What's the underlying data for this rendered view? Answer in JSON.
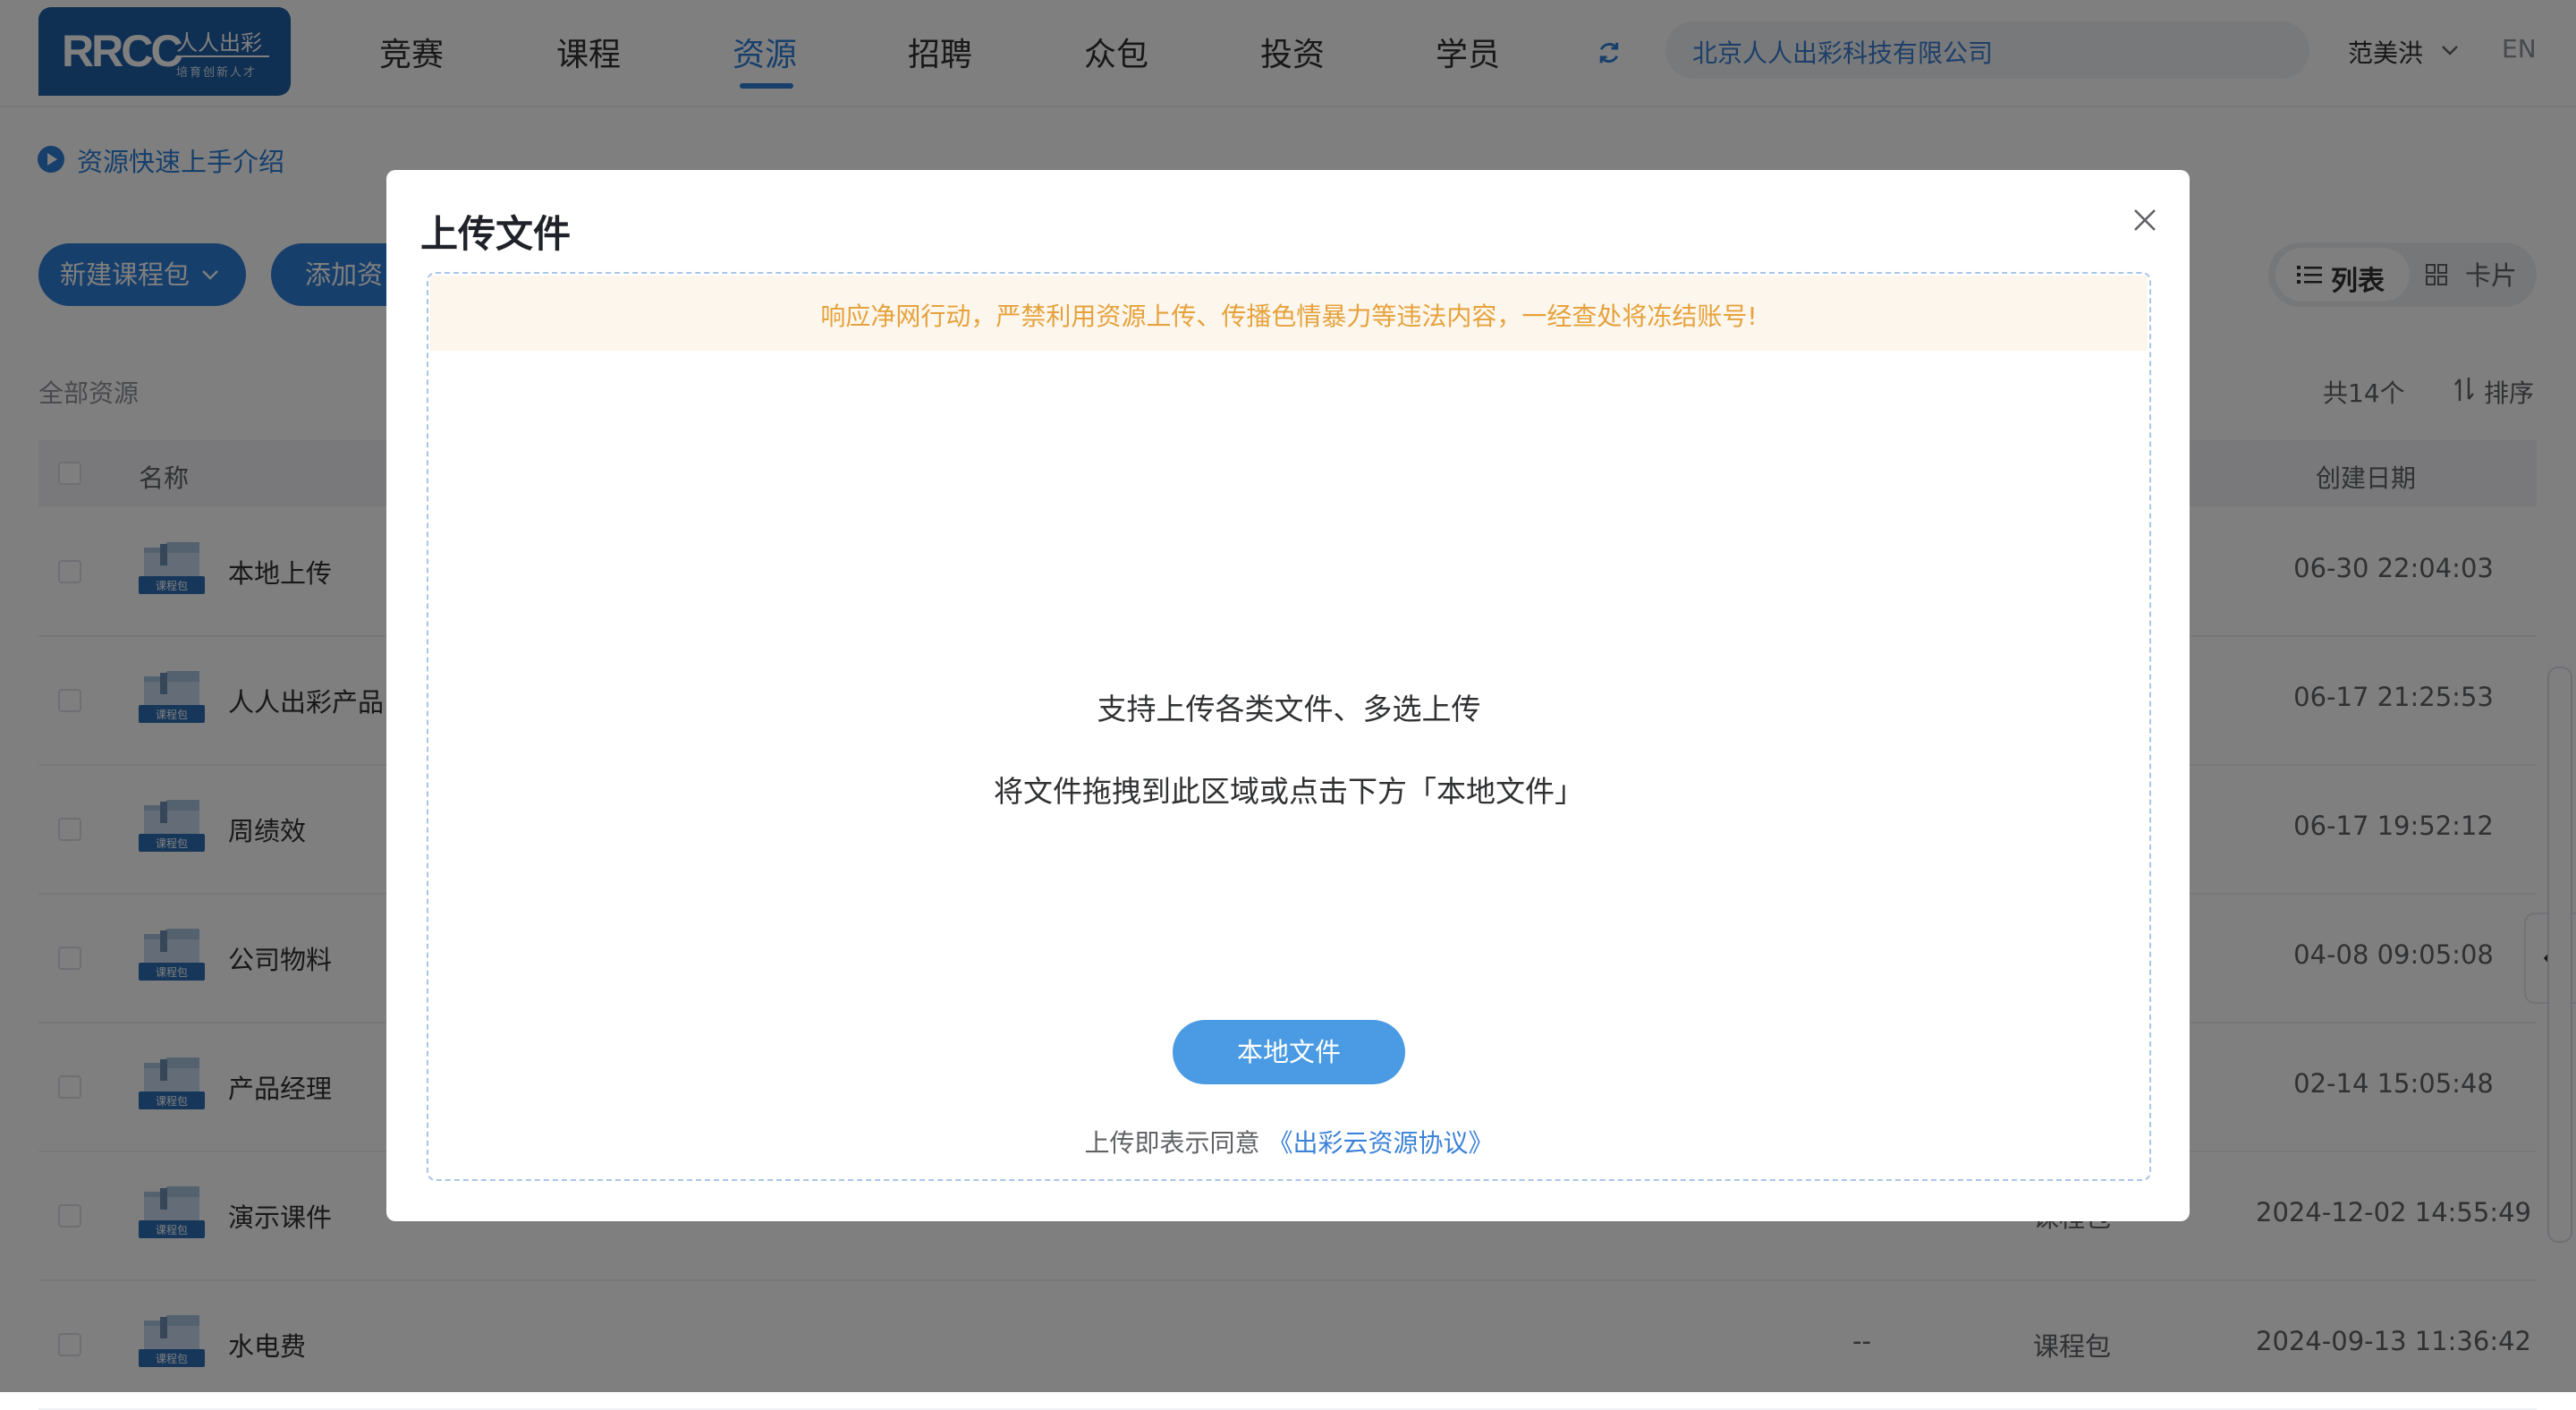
{
  "header": {
    "logo": {
      "mark": "RRCC",
      "cn": "人人出彩",
      "sub": "培育创新人才"
    },
    "nav": [
      "竞赛",
      "课程",
      "资源",
      "招聘",
      "众包",
      "投资",
      "学员"
    ],
    "active_nav": "资源",
    "company": "北京人人出彩科技有限公司",
    "user_name": "范美洪",
    "lang": "EN"
  },
  "page": {
    "intro_link": "资源快速上手介绍",
    "new_package_button": "新建课程包",
    "add_resource_button": "添加资",
    "view_list": "列表",
    "view_card": "卡片",
    "all_resources": "全部资源",
    "total": "共14个",
    "sort": "排序",
    "columns": {
      "name": "名称",
      "created": "创建日期"
    },
    "file_icon_label": "课程包",
    "rows": [
      {
        "name": "本地上传",
        "date": "06-30 22:04:03",
        "size": "",
        "type": ""
      },
      {
        "name": "人人出彩产品",
        "date": "06-17 21:25:53",
        "size": "",
        "type": ""
      },
      {
        "name": "周绩效",
        "date": "06-17 19:52:12",
        "size": "",
        "type": ""
      },
      {
        "name": "公司物料",
        "date": "04-08 09:05:08",
        "size": "",
        "type": ""
      },
      {
        "name": "产品经理",
        "date": "02-14 15:05:48",
        "size": "",
        "type": ""
      },
      {
        "name": "演示课件",
        "date": "2024-12-02 14:55:49",
        "size": "",
        "type": "课程包"
      },
      {
        "name": "水电费",
        "date": "2024-09-13 11:36:42",
        "size": "--",
        "type": "课程包"
      }
    ]
  },
  "modal": {
    "title": "上传文件",
    "notice": "响应净网行动，严禁利用资源上传、传播色情暴力等违法内容，一经查处将冻结账号!",
    "line1": "支持上传各类文件、多选上传",
    "line2": "将文件拖拽到此区域或点击下方「本地文件」",
    "local_button": "本地文件",
    "agree_prefix": "上传即表示同意",
    "agree_link": "《出彩云资源协议》"
  },
  "colors": {
    "primary": "#2f7fd6",
    "notice_bg": "#fdf6ec",
    "notice_text": "#e6a23c",
    "button": "#4a9be3"
  },
  "icons": [
    "refresh-icon",
    "chevron-down-icon",
    "play-circle-icon",
    "list-icon",
    "grid-icon",
    "sort-icon",
    "folder-package-icon",
    "close-icon",
    "chevron-left-icon"
  ]
}
